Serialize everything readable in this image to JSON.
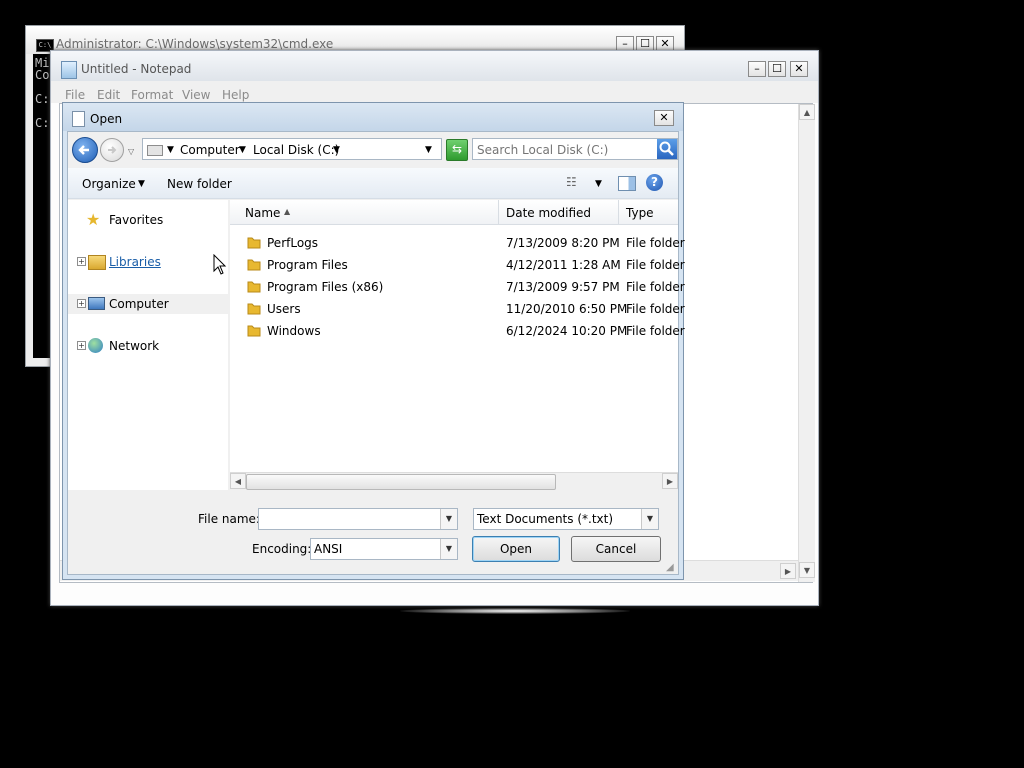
{
  "cmd": {
    "title": "Administrator: C:\\Windows\\system32\\cmd.exe",
    "icon_text": "C:\\",
    "lines": [
      "Mi",
      "Co",
      "C:",
      "C:"
    ]
  },
  "notepad": {
    "title": "Untitled - Notepad",
    "menu": [
      "File",
      "Edit",
      "Format",
      "View",
      "Help"
    ]
  },
  "dialog": {
    "title": "Open",
    "address": {
      "segments": [
        "Computer",
        "Local Disk (C:)"
      ]
    },
    "search_placeholder": "Search Local Disk (C:)",
    "toolbar": {
      "organize": "Organize",
      "new_folder": "New folder"
    },
    "nav": [
      {
        "label": "Favorites",
        "icon": "star-icon"
      },
      {
        "label": "Libraries",
        "icon": "libraries-icon"
      },
      {
        "label": "Computer",
        "icon": "computer-icon"
      },
      {
        "label": "Network",
        "icon": "network-icon"
      }
    ],
    "columns": [
      "Name",
      "Date modified",
      "Type"
    ],
    "files": [
      {
        "name": "PerfLogs",
        "date": "7/13/2009 8:20 PM",
        "type": "File folder"
      },
      {
        "name": "Program Files",
        "date": "4/12/2011 1:28 AM",
        "type": "File folder"
      },
      {
        "name": "Program Files (x86)",
        "date": "7/13/2009 9:57 PM",
        "type": "File folder"
      },
      {
        "name": "Users",
        "date": "11/20/2010 6:50 PM",
        "type": "File folder"
      },
      {
        "name": "Windows",
        "date": "6/12/2024 10:20 PM",
        "type": "File folder"
      }
    ],
    "file_name_label": "File name:",
    "file_name_value": "",
    "file_type": "Text Documents (*.txt)",
    "encoding_label": "Encoding:",
    "encoding_value": "ANSI",
    "open_label": "Open",
    "cancel_label": "Cancel"
  },
  "colors": {
    "accent": "#2a6fc9",
    "link": "#1a5ea8",
    "folder": "#e8b830"
  }
}
